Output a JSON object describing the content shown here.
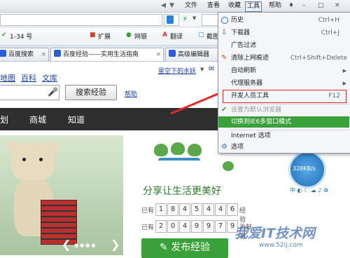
{
  "titlebar": {
    "menus": [
      "文件",
      "查看",
      "收藏",
      "工具",
      "帮助"
    ]
  },
  "favorites": {
    "count_label": "1-34 号",
    "items": [
      "扩展",
      "网银",
      "翻译",
      "截图"
    ]
  },
  "tabs": [
    "百度搜索",
    "百度经验——实用生活指南",
    "高级编辑器"
  ],
  "page": {
    "links": [
      "地图",
      "百科",
      "文库"
    ],
    "search_button": "搜索经验",
    "help": "帮助",
    "user": "星空下的水妖",
    "nav": [
      "划",
      "商城",
      "知道"
    ],
    "slogan": "分享让生活更美好",
    "stats": [
      {
        "prefix": "已有",
        "digits": [
          "1",
          "8",
          "4",
          "5",
          "4",
          "4",
          "6"
        ],
        "suffix": "经验"
      },
      {
        "prefix": "已有",
        "digits": [
          "2",
          "0",
          "4",
          "9",
          "9",
          "7",
          "9"
        ],
        "suffix": "贡献者"
      }
    ],
    "publish_button": "发布经验",
    "speed": "328KB/s",
    "speed_status": "中 ◐ ☾ ☁ ♪ ♻",
    "watermark": "我爱IT技术网",
    "watermark_url": "www.52ij.com"
  },
  "menu": {
    "items": [
      {
        "label": "历史",
        "shortcut": "Ctrl+H",
        "icon": "history-icon"
      },
      {
        "label": "下载器",
        "shortcut": "Ctrl+J",
        "icon": "download-icon"
      },
      {
        "label": "广告过滤",
        "shortcut": "",
        "icon": ""
      },
      {
        "label": "清除上网痕迹",
        "shortcut": "Ctrl+Shift+Delete",
        "icon": "clear-icon"
      },
      {
        "label": "自动刷新",
        "shortcut": "",
        "icon": "",
        "submenu": true
      },
      {
        "label": "代理服务器",
        "shortcut": "",
        "icon": "",
        "submenu": true
      },
      {
        "label": "开发人员工具",
        "shortcut": "F12",
        "icon": ""
      },
      {
        "label": "设置为默认浏览器",
        "shortcut": "",
        "icon": "check-icon"
      },
      {
        "label": "切换到IE6多窗口模式",
        "shortcut": "",
        "icon": ""
      },
      {
        "label": "Internet 选项",
        "shortcut": "",
        "icon": ""
      },
      {
        "label": "选项",
        "shortcut": "",
        "icon": "gear-icon"
      }
    ]
  },
  "colors": {
    "highlight_green": "#3aa13a",
    "annotation_red": "#e02a2a",
    "nav_dark": "#2f2f2f"
  }
}
